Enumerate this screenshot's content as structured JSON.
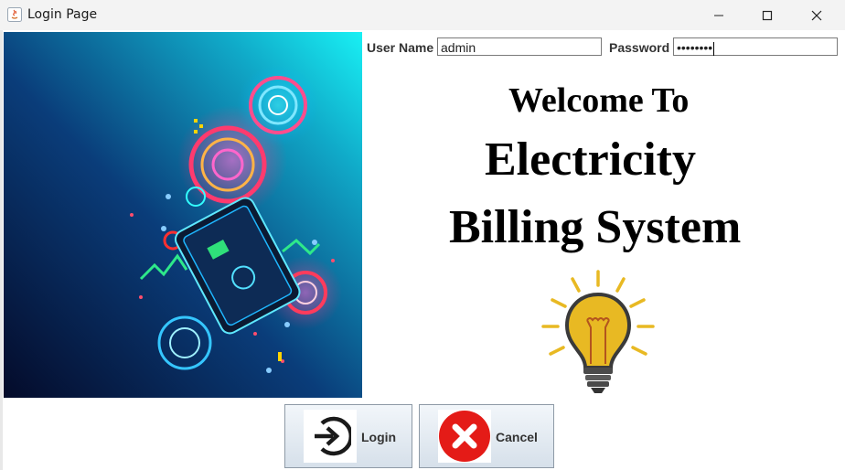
{
  "window": {
    "title": "Login Page",
    "controls": {
      "minimize": "minimize-icon",
      "maximize": "maximize-icon",
      "close": "close-icon"
    }
  },
  "form": {
    "username_label": "User Name",
    "username_value": "admin",
    "password_label": "Password",
    "password_value": "••••••••"
  },
  "heading": {
    "line1": "Welcome To",
    "line2": "Electricity",
    "line3": "Billing System"
  },
  "buttons": {
    "login_label": "Login",
    "cancel_label": "Cancel"
  },
  "colors": {
    "bulb_yellow": "#e8b923",
    "cancel_red": "#e41b17"
  }
}
